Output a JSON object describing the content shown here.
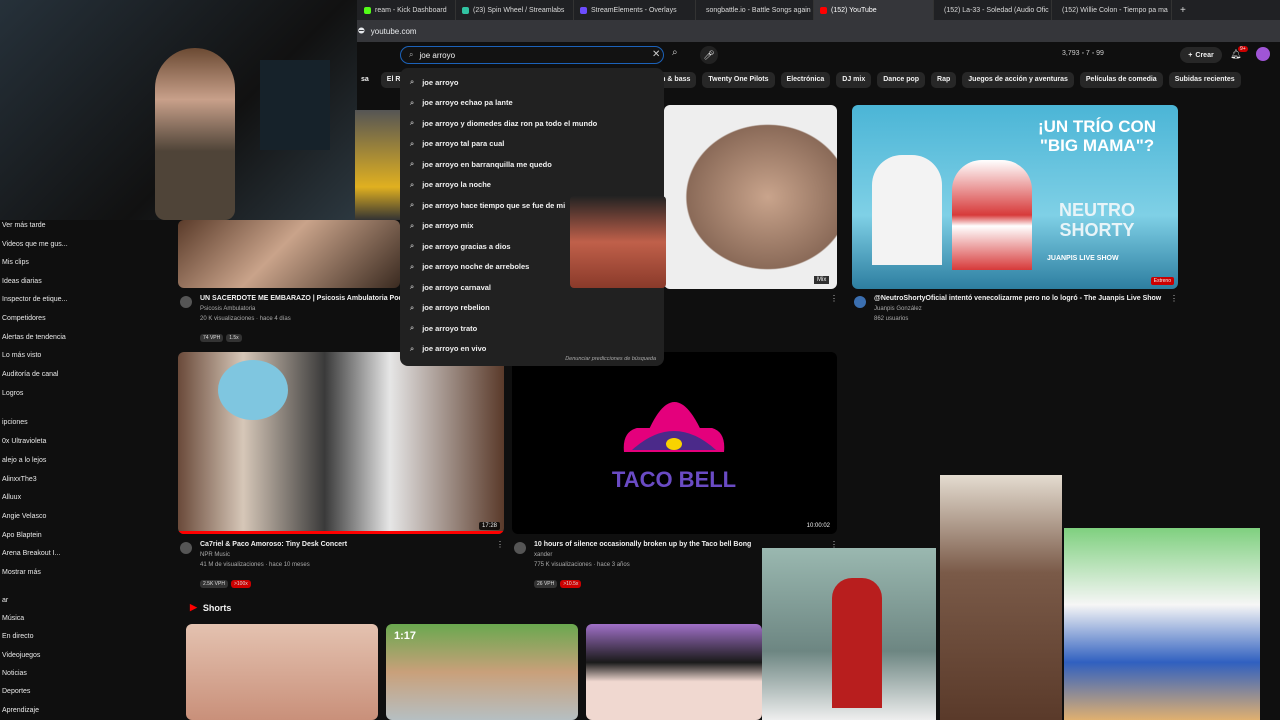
{
  "tabs": [
    {
      "label": "ream - Kick Dashboard",
      "color": "#53fc18"
    },
    {
      "label": "(23) Spin Wheel / Streamlabs",
      "color": "#31c3a2"
    },
    {
      "label": "StreamElements - Overlays",
      "color": "#6c4cff"
    },
    {
      "label": "songbattle.io - Battle Songs again",
      "color": "#888888"
    },
    {
      "label": "(152) YouTube",
      "color": "#ff0000"
    },
    {
      "label": "(152) La-33 - Soledad (Audio Ofic",
      "color": "#ff0000"
    },
    {
      "label": "(152) Willie Colon - Tiempo pa ma",
      "color": "#ff0000"
    }
  ],
  "address": "youtube.com",
  "search": {
    "value": "joe arroyo"
  },
  "header": {
    "stats": "3,793 ◦ 7 ◦ 99",
    "create": "Crear",
    "notif": "9+"
  },
  "chips": [
    "sa",
    "El Rub",
    "um & bass",
    "Twenty One Pilots",
    "Electrónica",
    "DJ mix",
    "Dance pop",
    "Rap",
    "Juegos de acción y aventuras",
    "Películas de comedia",
    "Subidas recientes"
  ],
  "suggestions": [
    "joe arroyo",
    "joe arroyo echao pa lante",
    "joe arroyo y diomedes diaz ron pa todo el mundo",
    "joe arroyo tal para cual",
    "joe arroyo en barranquilla me quedo",
    "joe arroyo la noche",
    "joe arroyo hace tiempo que se fue de mi",
    "joe arroyo mix",
    "joe arroyo gracias a dios",
    "joe arroyo noche de arreboles",
    "joe arroyo carnaval",
    "joe arroyo rebelion",
    "joe arroyo trato",
    "joe arroyo en vivo"
  ],
  "report": "Denunciar predicciones de búsqueda",
  "sidebar": [
    "Ver más tarde",
    "Videos que me gus...",
    "Mis clips",
    "Ideas diarias",
    "Inspector de etique...",
    "Competidores",
    "Alertas de tendencia",
    "Lo más visto",
    "Auditoría de canal",
    "Logros",
    "ipciones",
    "0x Ultravioleta",
    "alejo a lo lejos",
    "AlinxxThe3",
    "Alluux",
    "Angie Velasco",
    "Apo Blaptein",
    "Arena Breakout I...",
    "Mostrar más",
    "ar",
    "Música",
    "En directo",
    "Videojuegos",
    "Noticias",
    "Deportes",
    "Aprendizaje"
  ],
  "videos": [
    {
      "title": "UN SACERDOTE ME EMBARAZO | Psicosis Ambulatoria Pod",
      "channel": "Psicosis Ambulatoria",
      "meta": "20 K visualizaciones · hace 4 días",
      "b1": "74 VPH",
      "b2": "1.5x"
    },
    {
      "title": "@NeutroShortyOficial intentó venecolizarme pero no lo logró - The Juanpis Live Show",
      "channel": "Juanpis González",
      "meta": "862 usuarios",
      "overlay": "¡UN TRÍO CON \"BIG MAMA\"?",
      "overlay2": "NEUTRO SHORTY",
      "overlay3": "JUANPIS LIVE SHOW",
      "badge": "Estreno"
    },
    {
      "title": "Ca7riel & Paco Amoroso: Tiny Desk Concert",
      "channel": "NPR Music",
      "meta": "41 M de visualizaciones · hace 10 meses",
      "b1": "2.5K VPH",
      "b2": ">100x",
      "dur": "17:28"
    },
    {
      "title": "10 hours of silence occasionally broken up by the Taco bell Bong",
      "channel": "xander",
      "meta": "775 K visualizaciones · hace 3 años",
      "b1": "26 VPH",
      "b2": ">10.5x",
      "dur": "10:00:02",
      "logo": "TACO BELL"
    },
    {
      "mix": "Mix"
    }
  ],
  "shorts": {
    "label": "Shorts",
    "time": "1:17"
  }
}
